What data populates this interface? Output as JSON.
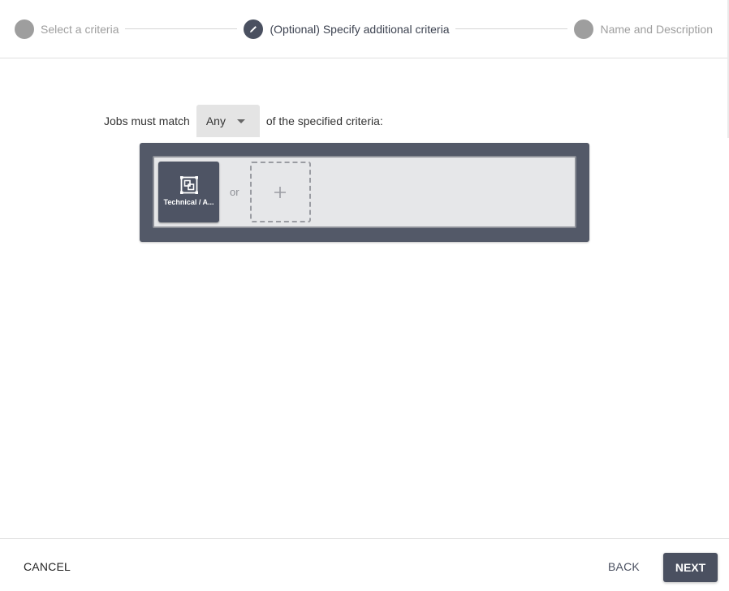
{
  "stepper": {
    "steps": [
      {
        "label": "Select a criteria",
        "state": "inactive",
        "icon": "circle"
      },
      {
        "label": "(Optional) Specify additional criteria",
        "state": "active",
        "icon": "pencil-icon"
      },
      {
        "label": "Name and Description",
        "state": "inactive",
        "icon": "circle"
      }
    ]
  },
  "match": {
    "prefix": "Jobs must match",
    "selected": "Any",
    "suffix": "of the specified criteria:"
  },
  "criteria": {
    "items": [
      {
        "label": "Technical / A...",
        "icon": "category-group-icon"
      }
    ],
    "separator": "or",
    "add_icon": "plus-icon"
  },
  "footer": {
    "cancel_label": "CANCEL",
    "back_label": "BACK",
    "next_label": "NEXT"
  },
  "colors": {
    "primary": "#4a5060",
    "panel": "#535968",
    "inactive_step": "#9e9e9e"
  }
}
